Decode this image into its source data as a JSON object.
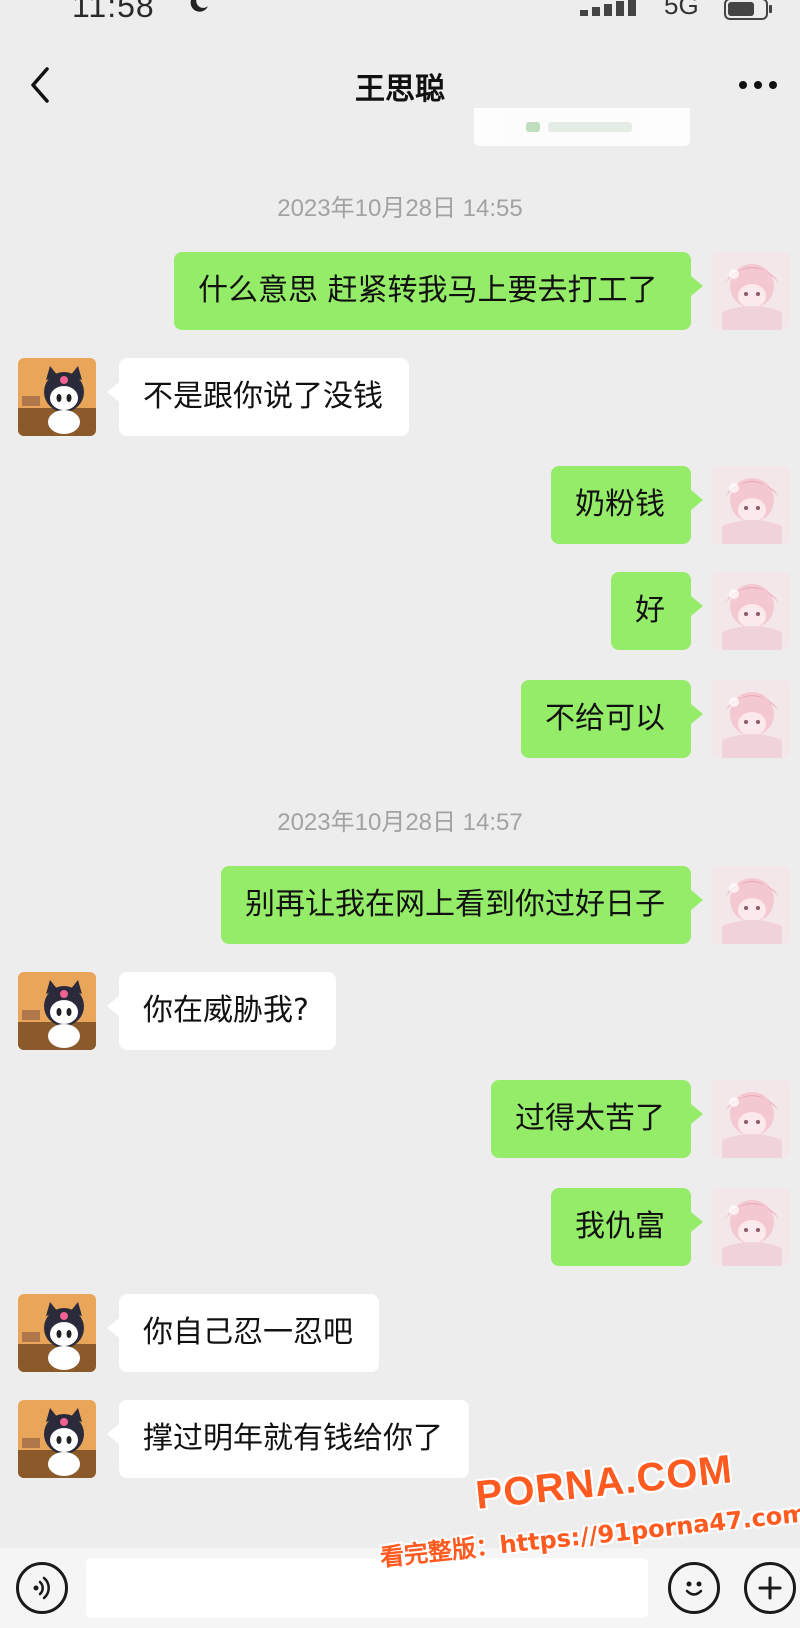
{
  "status_bar": {
    "time": "11:58",
    "network": "5G"
  },
  "header": {
    "title": "王思聪",
    "back_icon": "chevron-left-icon",
    "more_icon": "more-dots-icon"
  },
  "messages": [
    {
      "type": "time",
      "text": "2023年10月28日 14:55"
    },
    {
      "type": "msg",
      "side": "right",
      "text": "什么意思 赶紧转我马上要去打工了"
    },
    {
      "type": "msg",
      "side": "left",
      "text": "不是跟你说了没钱"
    },
    {
      "type": "msg",
      "side": "right",
      "text": "奶粉钱"
    },
    {
      "type": "msg",
      "side": "right",
      "text": "好"
    },
    {
      "type": "msg",
      "side": "right",
      "text": "不给可以"
    },
    {
      "type": "time",
      "text": "2023年10月28日 14:57"
    },
    {
      "type": "msg",
      "side": "right",
      "text": "别再让我在网上看到你过好日子"
    },
    {
      "type": "msg",
      "side": "left",
      "text": "你在威胁我?"
    },
    {
      "type": "msg",
      "side": "right",
      "text": "过得太苦了"
    },
    {
      "type": "msg",
      "side": "right",
      "text": "我仇富"
    },
    {
      "type": "msg",
      "side": "left",
      "text": "你自己忍一忍吧"
    },
    {
      "type": "msg",
      "side": "left",
      "text": "撑过明年就有钱给你了"
    }
  ],
  "input_bar": {
    "voice_icon": "voice-icon",
    "emoji_icon": "emoji-icon",
    "plus_icon": "plus-icon",
    "input_value": ""
  },
  "watermark": {
    "brand": "PORNA.COM",
    "url": "看完整版：https://91porna47.com"
  },
  "colors": {
    "background": "#EDEDED",
    "bubble_self": "#95EC69",
    "bubble_other": "#FFFFFF",
    "timestamp": "#A2A2A2",
    "watermark": "#FF5A1F"
  }
}
